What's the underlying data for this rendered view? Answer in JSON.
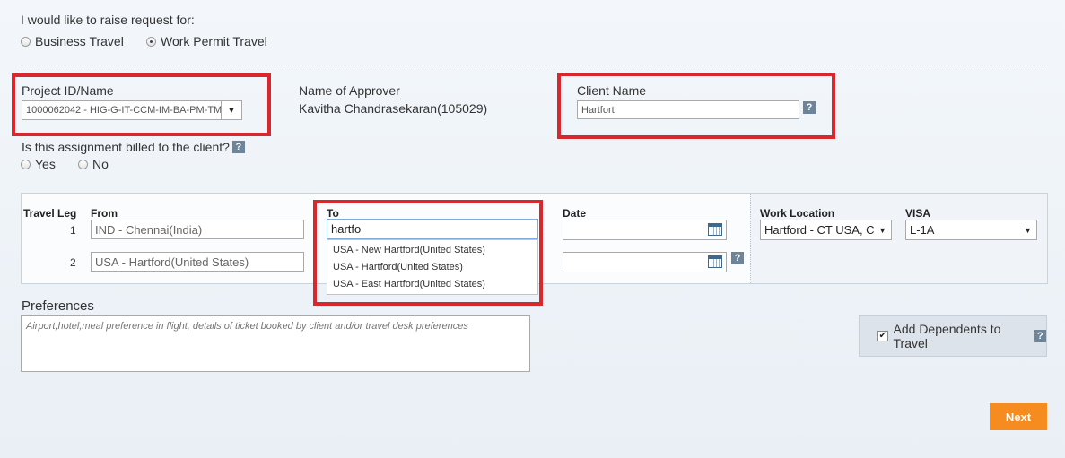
{
  "request": {
    "question": "I would like to raise request for:",
    "options": [
      "Business Travel",
      "Work Permit Travel"
    ],
    "selected": "Work Permit Travel"
  },
  "project": {
    "label": "Project ID/Name",
    "value": "1000062042 - HIG-G-IT-CCM-IM-BA-PM-TM"
  },
  "approver": {
    "label": "Name of Approver",
    "value": "Kavitha Chandrasekaran(105029)"
  },
  "client": {
    "label": "Client Name",
    "value": "Hartfort",
    "help": "?"
  },
  "billing": {
    "question": "Is this assignment billed to the client?",
    "help": "?",
    "options": [
      "Yes",
      "No"
    ]
  },
  "travel": {
    "headers": {
      "leg": "Travel Leg",
      "from": "From",
      "to": "To",
      "date": "Date",
      "work_location": "Work Location",
      "visa": "VISA"
    },
    "legs": [
      {
        "num": "1",
        "from": "IND - Chennai(India)",
        "to": "hartfo",
        "date": ""
      },
      {
        "num": "2",
        "from": "USA - Hartford(United States)",
        "to": "",
        "date": ""
      }
    ],
    "date_help": "?",
    "work_location": "Hartford - CT USA, C",
    "visa": "L-1A",
    "to_suggestions": [
      "USA - New Hartford(United States)",
      "USA - Hartford(United States)",
      "USA - East Hartford(United States)"
    ]
  },
  "preferences": {
    "label": "Preferences",
    "placeholder": "Airport,hotel,meal preference in flight, details of ticket booked by client and/or travel desk preferences"
  },
  "dependents": {
    "label": "Add Dependents to Travel",
    "checked": true,
    "help": "?"
  },
  "actions": {
    "next": "Next"
  },
  "colors": {
    "accent": "#f68b1f",
    "highlight": "#d9272e",
    "help_bg": "#6e8599"
  }
}
